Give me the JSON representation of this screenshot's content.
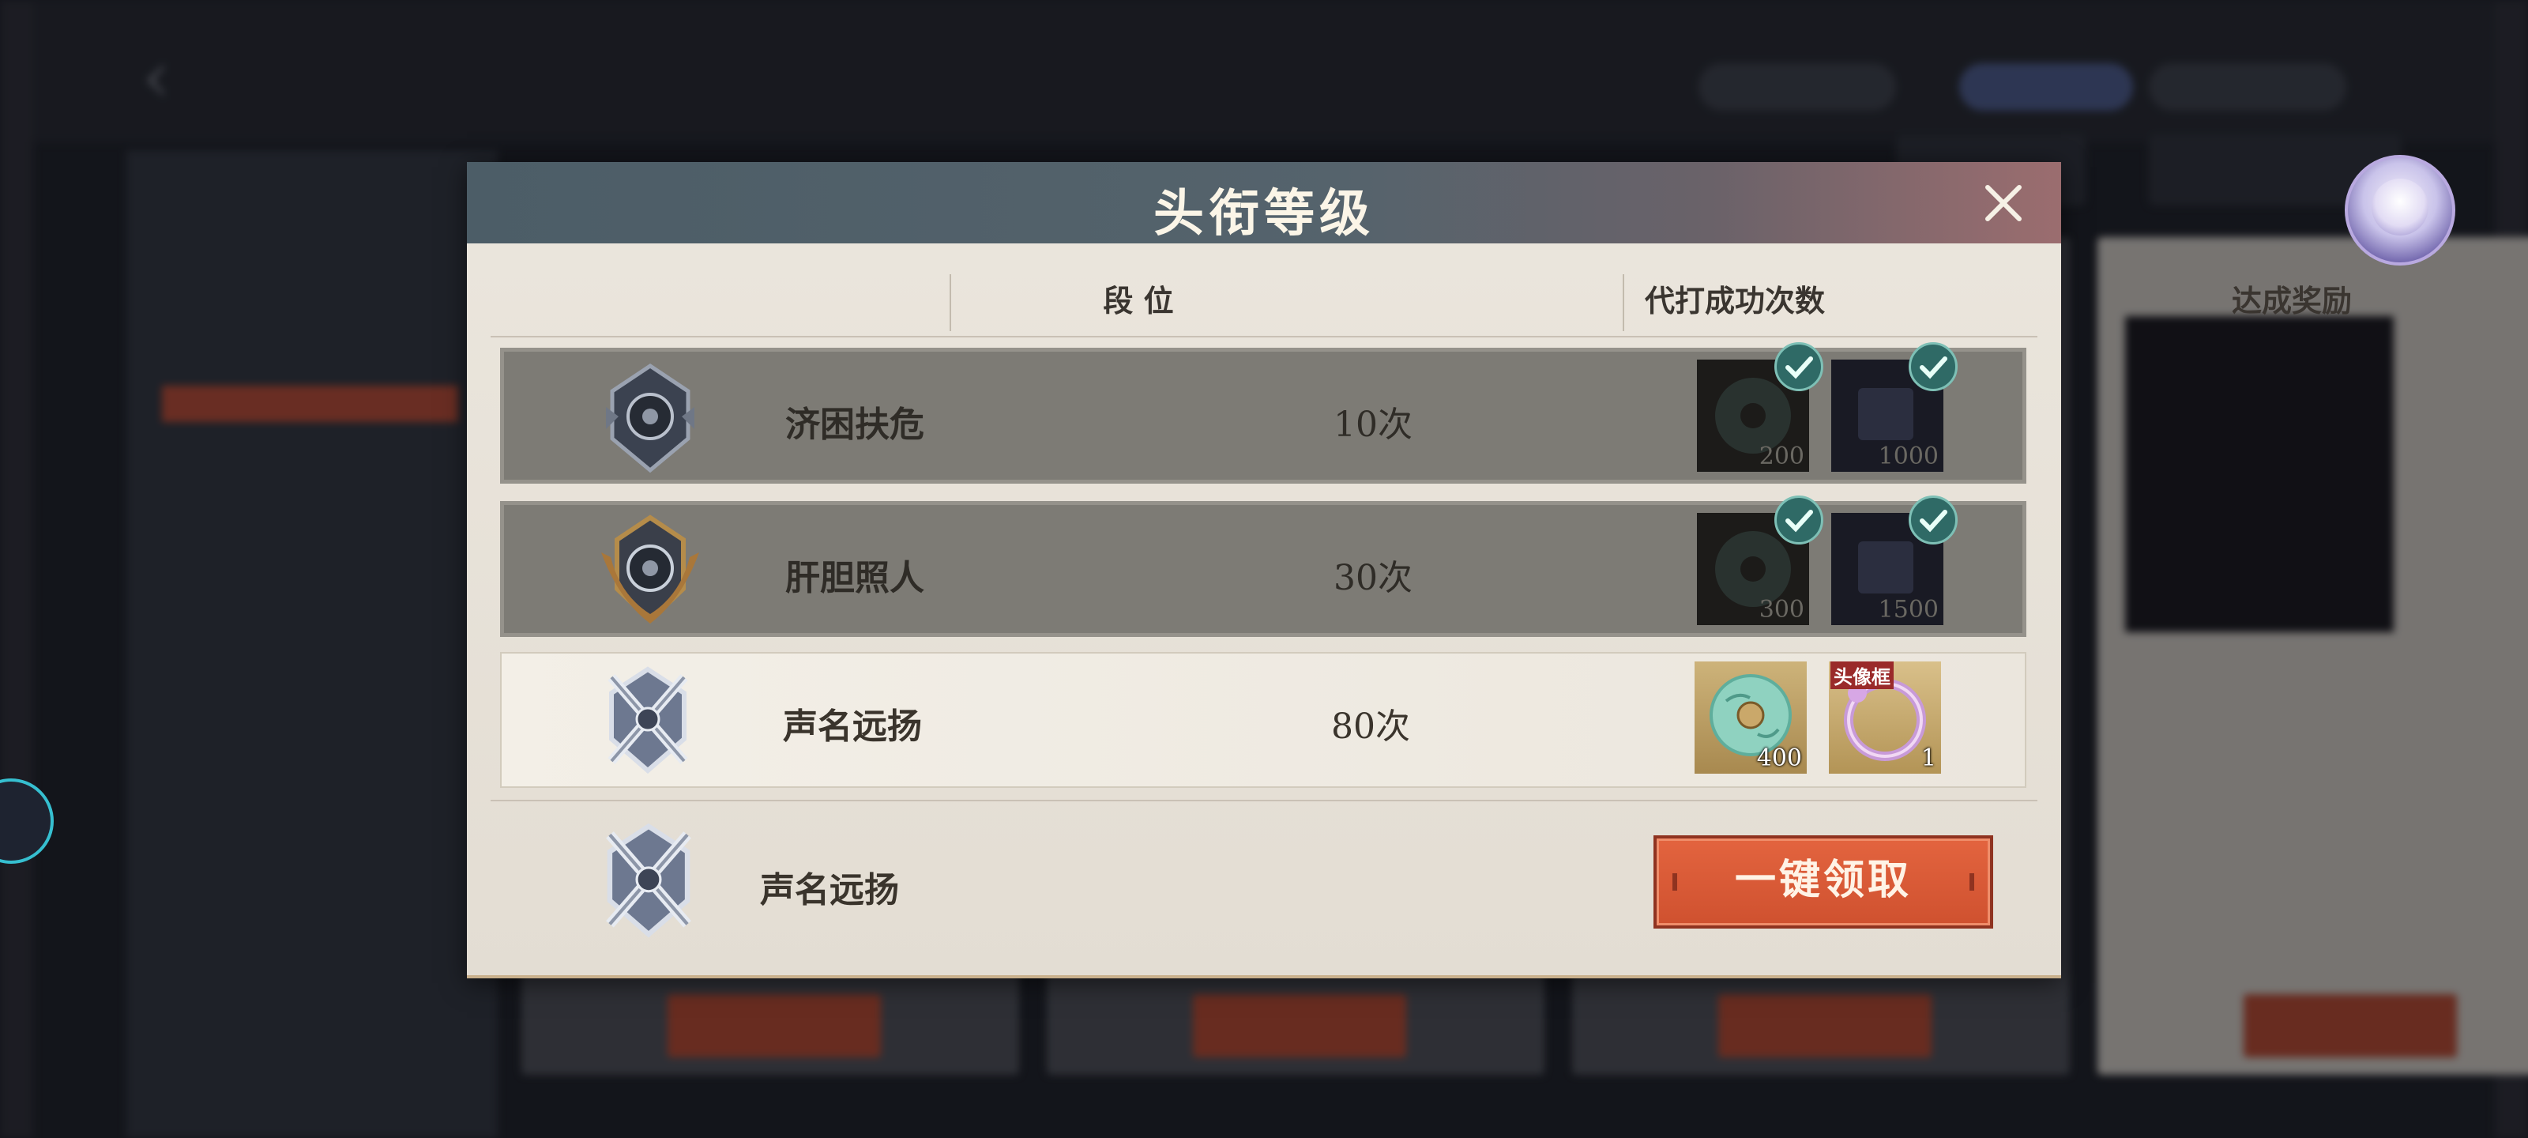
{
  "modal": {
    "title": "头衔等级",
    "columns": [
      "段 位",
      "代打成功次数",
      "达成奖励"
    ]
  },
  "rows": [
    {
      "rank": "济困扶危",
      "count": "10次",
      "state": "claimed",
      "rewards": [
        {
          "icon": "jade-pendant-icon",
          "qty": "200",
          "claimed": true
        },
        {
          "icon": "scroll-chest-icon",
          "qty": "1000",
          "claimed": true
        }
      ]
    },
    {
      "rank": "肝胆照人",
      "count": "30次",
      "state": "claimed",
      "rewards": [
        {
          "icon": "jade-pendant-icon",
          "qty": "300",
          "claimed": true
        },
        {
          "icon": "scroll-chest-icon",
          "qty": "1500",
          "claimed": true
        }
      ]
    },
    {
      "rank": "声名远扬",
      "count": "80次",
      "state": "available",
      "rewards": [
        {
          "icon": "jade-pendant-icon",
          "qty": "400",
          "claimed": false
        },
        {
          "icon": "avatar-frame-icon",
          "qty": "1",
          "tag": "头像框",
          "claimed": false
        }
      ]
    }
  ],
  "current": {
    "rank": "声名远扬",
    "claim_label": "一键领取"
  },
  "colors": {
    "accent": "#d85a37",
    "header": "#4c5d67",
    "panel": "#e8e3da",
    "claimed_row": "#7d7b75"
  }
}
